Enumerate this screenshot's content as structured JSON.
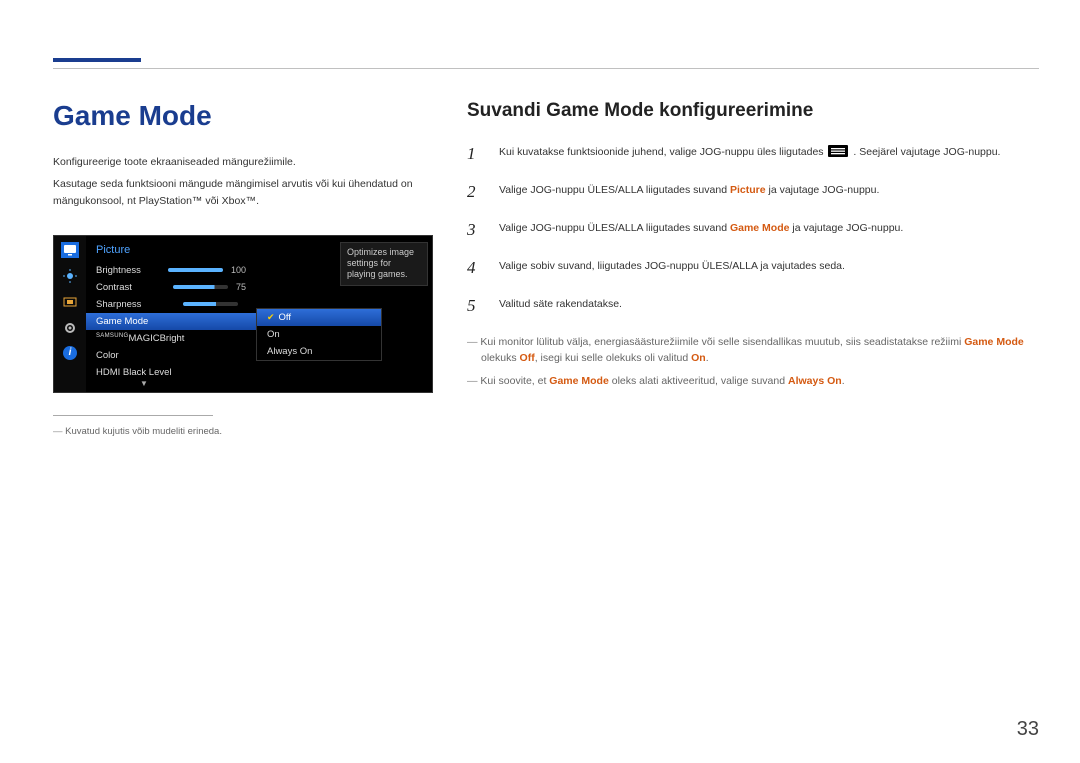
{
  "title": "Game Mode",
  "intro": [
    "Konfigureerige toote ekraaniseaded mängurežiimile.",
    "Kasutage seda funktsiooni mängude mängimisel arvutis või kui ühendatud on mängukonsool, nt PlayStation™ või Xbox™."
  ],
  "osd": {
    "section_title": "Picture",
    "rows": [
      {
        "label": "Brightness",
        "value": "100",
        "bar_pct": 100
      },
      {
        "label": "Contrast",
        "value": "75",
        "bar_pct": 75
      },
      {
        "label": "Sharpness",
        "value": "",
        "bar_pct": 60
      },
      {
        "label": "Game Mode",
        "value": "",
        "selected": true
      },
      {
        "label_html": "MAGICBright",
        "sup": "SAMSUNG",
        "value": ""
      },
      {
        "label": "Color",
        "value": ""
      },
      {
        "label": "HDMI Black Level",
        "value": ""
      }
    ],
    "submenu": [
      {
        "label": "Off",
        "selected": true,
        "checked": true
      },
      {
        "label": "On"
      },
      {
        "label": "Always On"
      }
    ],
    "tooltip": "Optimizes image settings for playing games."
  },
  "footnote_left": "Kuvatud kujutis võib mudeliti erineda.",
  "subtitle": "Suvandi Game Mode konfigureerimine",
  "steps": [
    {
      "n": "1",
      "pre": "Kui kuvatakse funktsioonide juhend, valige JOG-nuppu üles liigutades ",
      "post": ". Seejärel vajutage JOG-nuppu.",
      "has_icon": true
    },
    {
      "n": "2",
      "text_parts": [
        "Valige JOG-nuppu ÜLES/ALLA liigutades suvand ",
        {
          "hl": "Picture"
        },
        " ja vajutage JOG-nuppu."
      ]
    },
    {
      "n": "3",
      "text_parts": [
        "Valige JOG-nuppu ÜLES/ALLA liigutades suvand ",
        {
          "hl": "Game Mode"
        },
        " ja vajutage JOG-nuppu."
      ]
    },
    {
      "n": "4",
      "text_parts": [
        "Valige sobiv suvand, liigutades JOG-nuppu ÜLES/ALLA ja vajutades seda."
      ]
    },
    {
      "n": "5",
      "text_parts": [
        "Valitud säte rakendatakse."
      ]
    }
  ],
  "notes": [
    {
      "parts": [
        "Kui monitor lülitub välja, energiasäästurežiimile või selle sisendallikas muutub, siis seadistatakse režiimi ",
        {
          "hl": "Game Mode"
        },
        " olekuks ",
        {
          "hl": "Off"
        },
        ", isegi kui selle olekuks oli valitud ",
        {
          "hl": "On"
        },
        "."
      ]
    },
    {
      "parts": [
        "Kui soovite, et ",
        {
          "hl": "Game Mode"
        },
        " oleks alati aktiveeritud, valige suvand ",
        {
          "hl": "Always On"
        },
        "."
      ]
    }
  ],
  "page_number": "33"
}
